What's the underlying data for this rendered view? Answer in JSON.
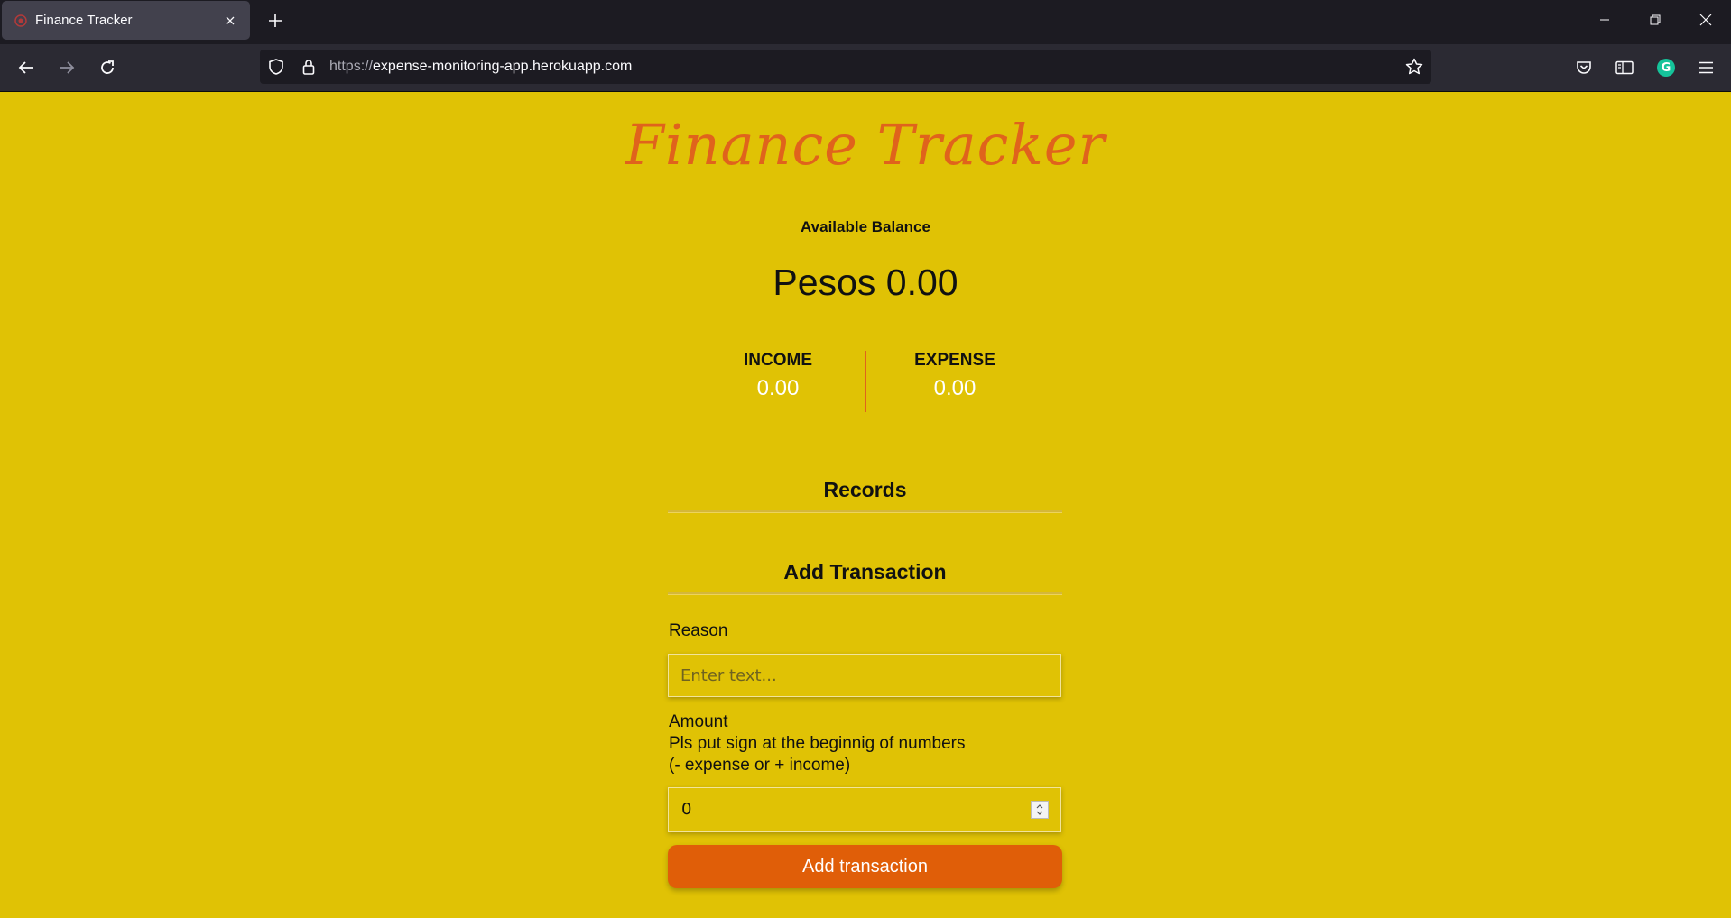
{
  "browser": {
    "tab_title": "Finance Tracker",
    "url_scheme": "https://",
    "url_host": "expense-monitoring-app.herokuapp.com",
    "accent_color": "#15c39a"
  },
  "app": {
    "title": "Finance Tracker",
    "title_color": "#e0631c",
    "background_color": "#e0c205",
    "balance": {
      "label": "Available Balance",
      "value": "Pesos 0.00"
    },
    "income": {
      "label": "INCOME",
      "value": "0.00"
    },
    "expense": {
      "label": "EXPENSE",
      "value": "0.00"
    },
    "records": {
      "title": "Records"
    },
    "add_transaction": {
      "title": "Add Transaction",
      "reason_label": "Reason",
      "reason_placeholder": "Enter text...",
      "reason_value": "",
      "amount_label": "Amount",
      "amount_hint_1": "Pls put sign at the beginnig of numbers",
      "amount_hint_2": "(- expense or + income)",
      "amount_value": "0",
      "button_label": "Add transaction",
      "button_color": "#e05e08"
    }
  }
}
